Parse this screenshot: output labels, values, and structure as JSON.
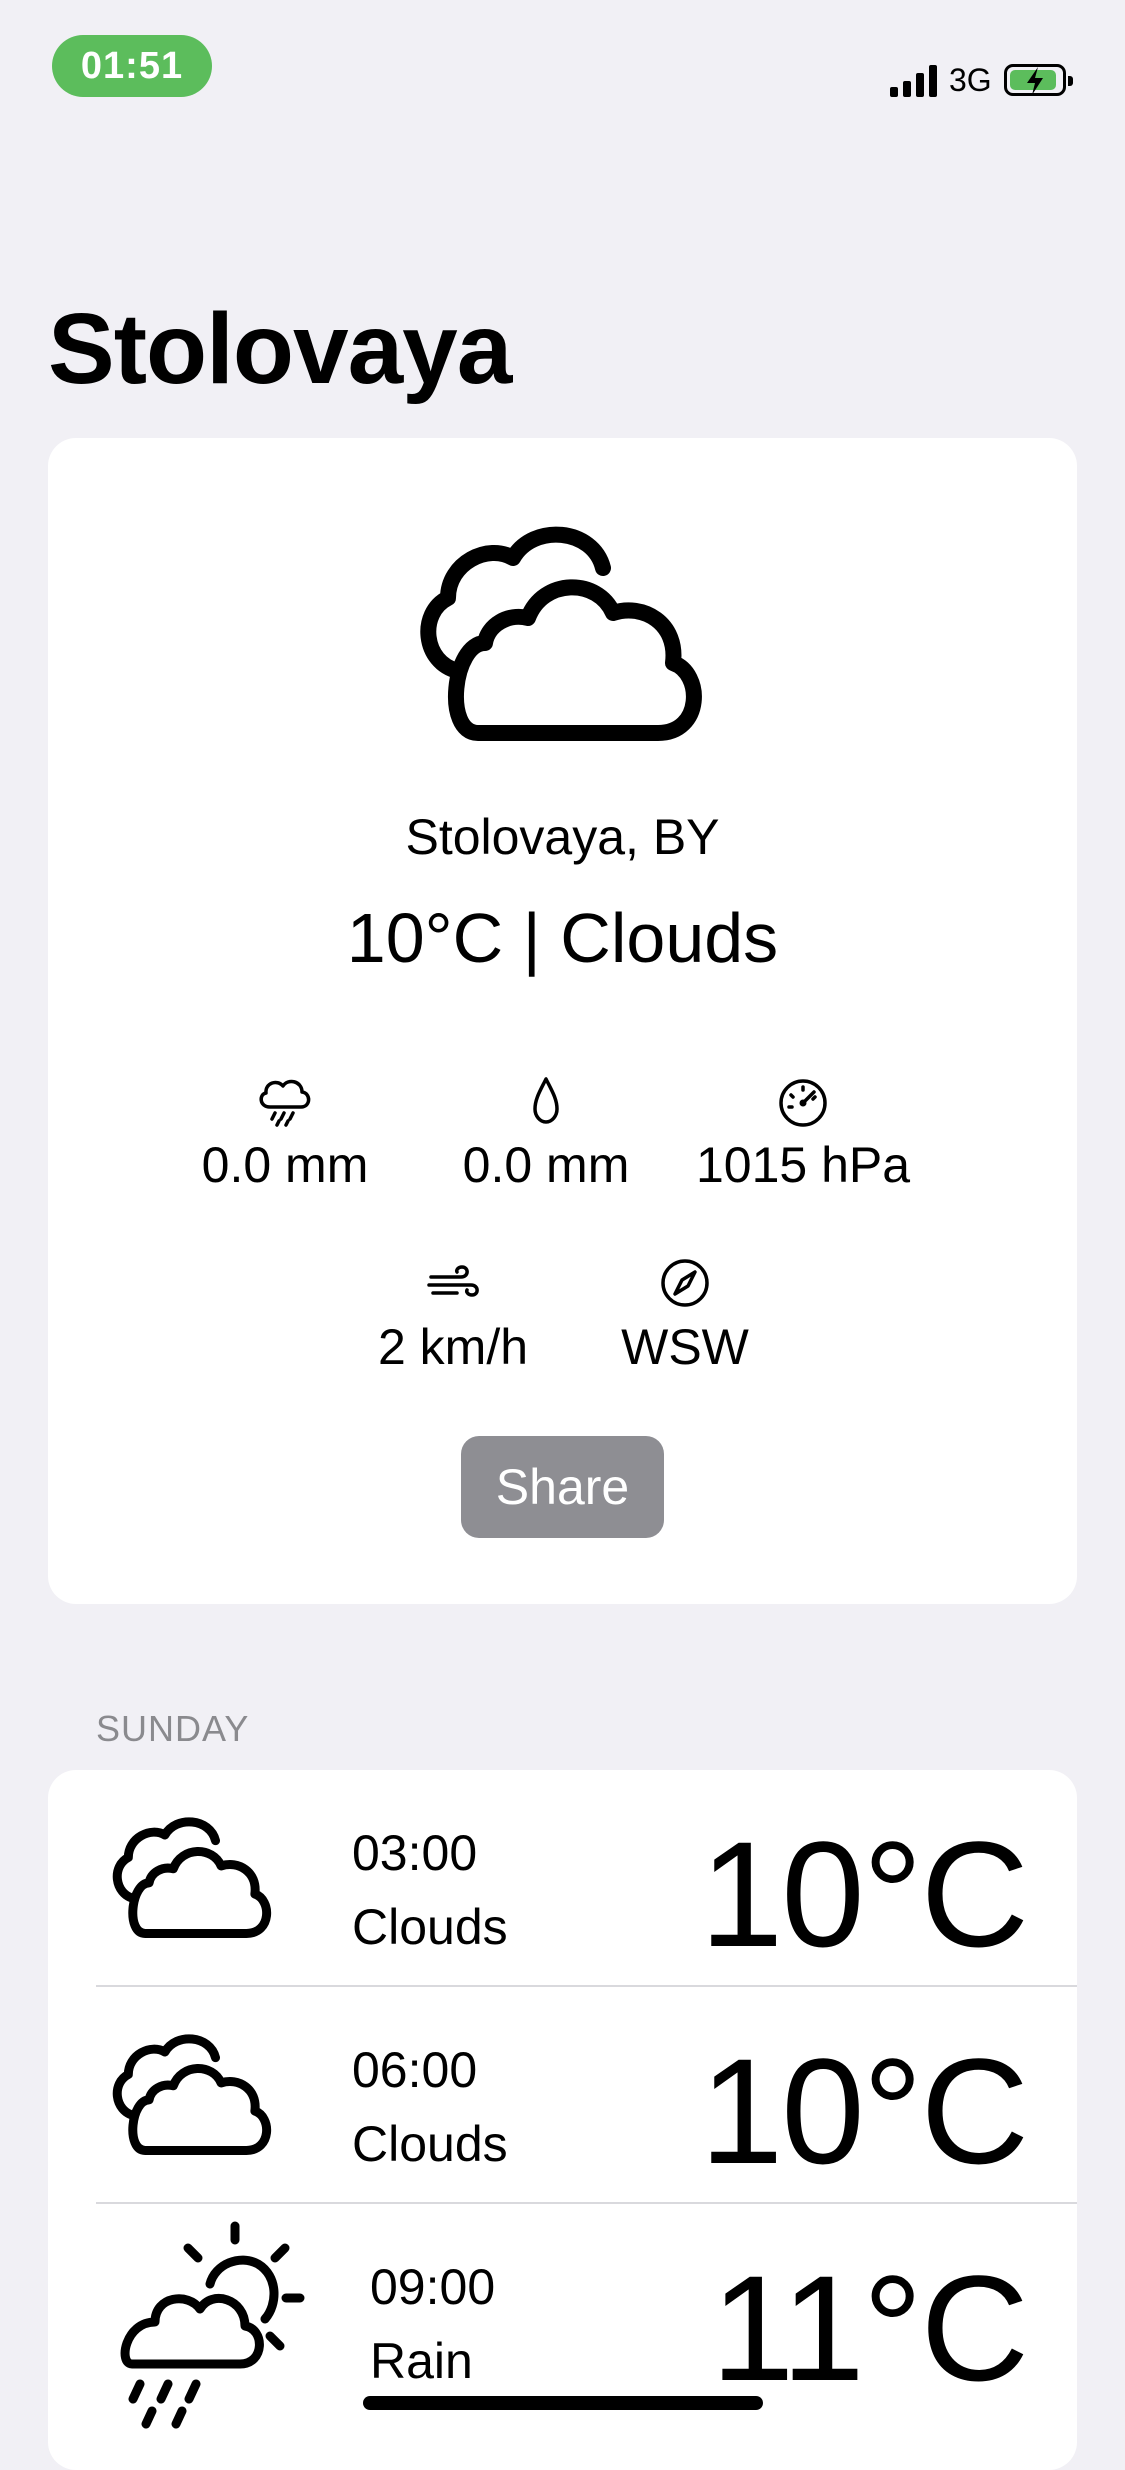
{
  "status_bar": {
    "time": "01:51",
    "network": "3G",
    "accent_color": "#5cbd5c"
  },
  "page": {
    "title": "Stolovaya"
  },
  "current": {
    "icon": "clouds-icon",
    "location": "Stolovaya, BY",
    "summary": "10°C | Clouds",
    "metrics": [
      {
        "icon": "rain-cloud-icon",
        "value": "0.0 mm"
      },
      {
        "icon": "water-drop-icon",
        "value": "0.0 mm"
      },
      {
        "icon": "gauge-icon",
        "value": "1015 hPa"
      },
      {
        "icon": "wind-icon",
        "value": "2 km/h"
      },
      {
        "icon": "compass-icon",
        "value": "WSW"
      }
    ],
    "share_label": "Share"
  },
  "forecast": {
    "day_label": "SUNDAY",
    "items": [
      {
        "time": "03:00",
        "condition": "Clouds",
        "temp": "10°C",
        "icon": "clouds-icon"
      },
      {
        "time": "06:00",
        "condition": "Clouds",
        "temp": "10°C",
        "icon": "clouds-icon"
      },
      {
        "time": "09:00",
        "condition": "Rain",
        "temp": "11°C",
        "icon": "sun-rain-cloud-icon"
      }
    ]
  }
}
